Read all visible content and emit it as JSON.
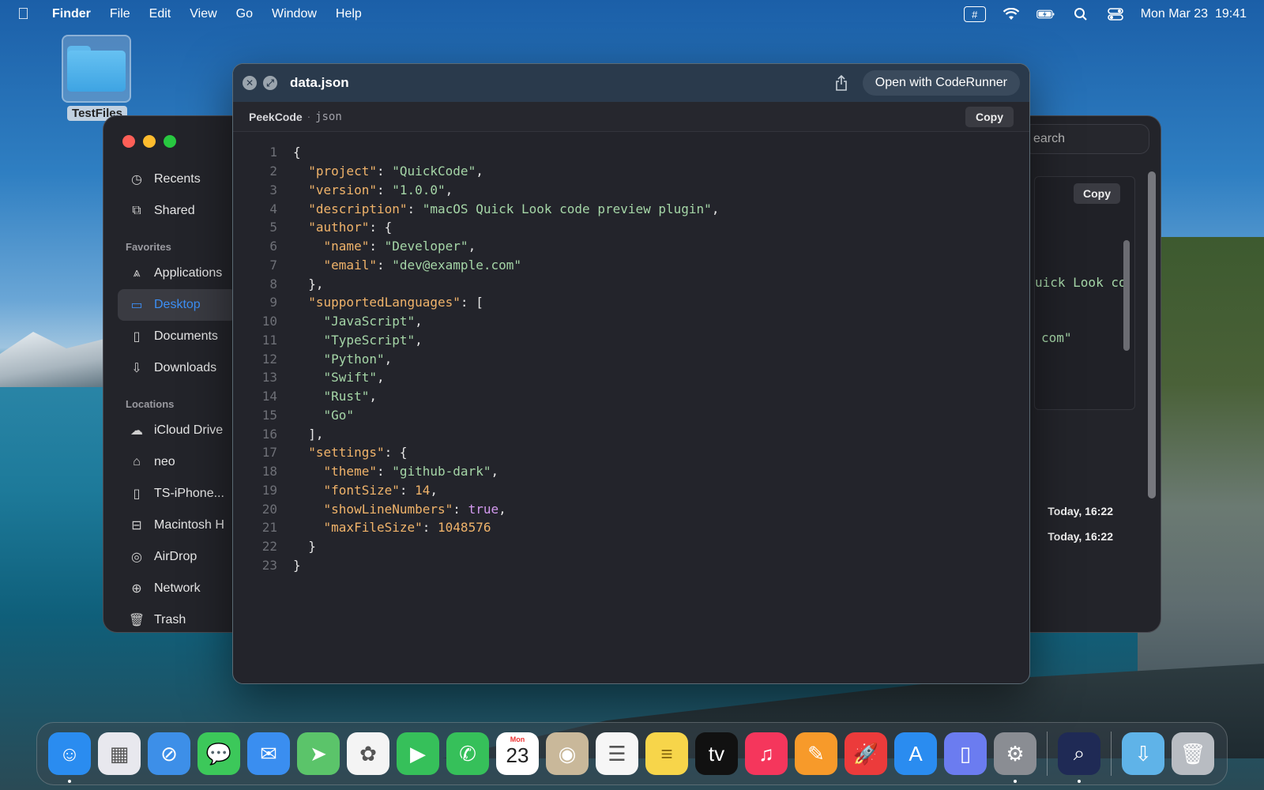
{
  "menubar": {
    "app_name": "Finder",
    "menus": [
      "File",
      "Edit",
      "View",
      "Go",
      "Window",
      "Help"
    ],
    "clock": "Mon Mar 23  19:41",
    "status_icons": [
      "input-method-icon",
      "wifi-icon",
      "battery-icon",
      "spotlight-search-icon",
      "control-center-icon"
    ]
  },
  "desktop": {
    "folder_label": "TestFiles"
  },
  "finder": {
    "search_placeholder": "earch",
    "sidebar": {
      "items_top": [
        {
          "label": "Recents",
          "icon": "clock-icon"
        },
        {
          "label": "Shared",
          "icon": "shared-folder-icon"
        }
      ],
      "favorites_label": "Favorites",
      "favorites": [
        {
          "label": "Applications",
          "icon": "applications-icon"
        },
        {
          "label": "Desktop",
          "icon": "desktop-icon",
          "active": true
        },
        {
          "label": "Documents",
          "icon": "document-icon"
        },
        {
          "label": "Downloads",
          "icon": "download-icon"
        }
      ],
      "locations_label": "Locations",
      "locations": [
        {
          "label": "iCloud Drive",
          "icon": "cloud-icon"
        },
        {
          "label": "neo",
          "icon": "home-icon"
        },
        {
          "label": "TS-iPhone...",
          "icon": "iphone-icon"
        },
        {
          "label": "Macintosh H",
          "icon": "disk-icon"
        },
        {
          "label": "AirDrop",
          "icon": "airdrop-icon"
        },
        {
          "label": "Network",
          "icon": "network-icon"
        },
        {
          "label": "Trash",
          "icon": "trash-icon"
        }
      ]
    },
    "preview_copy_label": "Copy",
    "preview_fragments": [
      "uick Look co",
      "com\""
    ],
    "dates": [
      "Today, 16:22",
      "Today, 16:22"
    ]
  },
  "quicklook": {
    "title": "data.json",
    "open_with_label": "Open with CodeRunner",
    "plugin_name": "PeekCode",
    "separator": "·",
    "language": "json",
    "copy_label": "Copy",
    "lines": [
      [
        {
          "t": "p",
          "v": "{"
        }
      ],
      [
        {
          "t": "p",
          "v": "  "
        },
        {
          "t": "key",
          "v": "\"project\""
        },
        {
          "t": "p",
          "v": ": "
        },
        {
          "t": "str",
          "v": "\"QuickCode\""
        },
        {
          "t": "p",
          "v": ","
        }
      ],
      [
        {
          "t": "p",
          "v": "  "
        },
        {
          "t": "key",
          "v": "\"version\""
        },
        {
          "t": "p",
          "v": ": "
        },
        {
          "t": "str",
          "v": "\"1.0.0\""
        },
        {
          "t": "p",
          "v": ","
        }
      ],
      [
        {
          "t": "p",
          "v": "  "
        },
        {
          "t": "key",
          "v": "\"description\""
        },
        {
          "t": "p",
          "v": ": "
        },
        {
          "t": "str",
          "v": "\"macOS Quick Look code preview plugin\""
        },
        {
          "t": "p",
          "v": ","
        }
      ],
      [
        {
          "t": "p",
          "v": "  "
        },
        {
          "t": "key",
          "v": "\"author\""
        },
        {
          "t": "p",
          "v": ": {"
        }
      ],
      [
        {
          "t": "p",
          "v": "    "
        },
        {
          "t": "key",
          "v": "\"name\""
        },
        {
          "t": "p",
          "v": ": "
        },
        {
          "t": "str",
          "v": "\"Developer\""
        },
        {
          "t": "p",
          "v": ","
        }
      ],
      [
        {
          "t": "p",
          "v": "    "
        },
        {
          "t": "key",
          "v": "\"email\""
        },
        {
          "t": "p",
          "v": ": "
        },
        {
          "t": "str",
          "v": "\"dev@example.com\""
        }
      ],
      [
        {
          "t": "p",
          "v": "  },"
        }
      ],
      [
        {
          "t": "p",
          "v": "  "
        },
        {
          "t": "key",
          "v": "\"supportedLanguages\""
        },
        {
          "t": "p",
          "v": ": ["
        }
      ],
      [
        {
          "t": "p",
          "v": "    "
        },
        {
          "t": "str",
          "v": "\"JavaScript\""
        },
        {
          "t": "p",
          "v": ","
        }
      ],
      [
        {
          "t": "p",
          "v": "    "
        },
        {
          "t": "str",
          "v": "\"TypeScript\""
        },
        {
          "t": "p",
          "v": ","
        }
      ],
      [
        {
          "t": "p",
          "v": "    "
        },
        {
          "t": "str",
          "v": "\"Python\""
        },
        {
          "t": "p",
          "v": ","
        }
      ],
      [
        {
          "t": "p",
          "v": "    "
        },
        {
          "t": "str",
          "v": "\"Swift\""
        },
        {
          "t": "p",
          "v": ","
        }
      ],
      [
        {
          "t": "p",
          "v": "    "
        },
        {
          "t": "str",
          "v": "\"Rust\""
        },
        {
          "t": "p",
          "v": ","
        }
      ],
      [
        {
          "t": "p",
          "v": "    "
        },
        {
          "t": "str",
          "v": "\"Go\""
        }
      ],
      [
        {
          "t": "p",
          "v": "  ],"
        }
      ],
      [
        {
          "t": "p",
          "v": "  "
        },
        {
          "t": "key",
          "v": "\"settings\""
        },
        {
          "t": "p",
          "v": ": {"
        }
      ],
      [
        {
          "t": "p",
          "v": "    "
        },
        {
          "t": "key",
          "v": "\"theme\""
        },
        {
          "t": "p",
          "v": ": "
        },
        {
          "t": "str",
          "v": "\"github-dark\""
        },
        {
          "t": "p",
          "v": ","
        }
      ],
      [
        {
          "t": "p",
          "v": "    "
        },
        {
          "t": "key",
          "v": "\"fontSize\""
        },
        {
          "t": "p",
          "v": ": "
        },
        {
          "t": "num",
          "v": "14"
        },
        {
          "t": "p",
          "v": ","
        }
      ],
      [
        {
          "t": "p",
          "v": "    "
        },
        {
          "t": "key",
          "v": "\"showLineNumbers\""
        },
        {
          "t": "p",
          "v": ": "
        },
        {
          "t": "kw",
          "v": "true"
        },
        {
          "t": "p",
          "v": ","
        }
      ],
      [
        {
          "t": "p",
          "v": "    "
        },
        {
          "t": "key",
          "v": "\"maxFileSize\""
        },
        {
          "t": "p",
          "v": ": "
        },
        {
          "t": "num",
          "v": "1048576"
        }
      ],
      [
        {
          "t": "p",
          "v": "  }"
        }
      ],
      [
        {
          "t": "p",
          "v": "}"
        }
      ]
    ]
  },
  "dock": {
    "apps": [
      {
        "name": "finder-app-icon",
        "color": "#2a8cf0",
        "glyph": "☺",
        "running": true
      },
      {
        "name": "launchpad-app-icon",
        "color": "#e8e8ee",
        "glyph": "▦",
        "running": false
      },
      {
        "name": "safari-app-icon",
        "color": "#3d8fe8",
        "glyph": "⊘",
        "running": false
      },
      {
        "name": "messages-app-icon",
        "color": "#3cc85a",
        "glyph": "💬",
        "running": false
      },
      {
        "name": "mail-app-icon",
        "color": "#3a8ef0",
        "glyph": "✉",
        "running": false
      },
      {
        "name": "maps-app-icon",
        "color": "#5bc46a",
        "glyph": "➤",
        "running": false
      },
      {
        "name": "photos-app-icon",
        "color": "#f4f4f4",
        "glyph": "✿",
        "running": false
      },
      {
        "name": "facetime-app-icon",
        "color": "#36c05a",
        "glyph": "▶",
        "running": false
      },
      {
        "name": "phone-app-icon",
        "color": "#36c05a",
        "glyph": "✆",
        "running": false
      },
      {
        "name": "calendar-app-icon",
        "color": "#ffffff",
        "glyph": "",
        "running": false,
        "cal_day": "Mon",
        "cal_num": "23"
      },
      {
        "name": "contacts-app-icon",
        "color": "#c9b89a",
        "glyph": "◉",
        "running": false
      },
      {
        "name": "reminders-app-icon",
        "color": "#f6f6f6",
        "glyph": "☰",
        "running": false
      },
      {
        "name": "notes-app-icon",
        "color": "#f7d54a",
        "glyph": "≡",
        "running": false
      },
      {
        "name": "apple-tv-app-icon",
        "color": "#111111",
        "glyph": "tv",
        "running": false
      },
      {
        "name": "music-app-icon",
        "color": "#f5365c",
        "glyph": "♫",
        "running": false
      },
      {
        "name": "pages-app-icon",
        "color": "#f79a2a",
        "glyph": "✎",
        "running": false
      },
      {
        "name": "rocket-app-icon",
        "color": "#ec3b3b",
        "glyph": "🚀",
        "running": false
      },
      {
        "name": "app-store-app-icon",
        "color": "#2a8cf0",
        "glyph": "A",
        "running": false
      },
      {
        "name": "iphone-mirroring-app-icon",
        "color": "#6b7cf0",
        "glyph": "▯",
        "running": false
      },
      {
        "name": "system-settings-app-icon",
        "color": "#8a8d93",
        "glyph": "⚙",
        "running": true
      },
      {
        "sep": true
      },
      {
        "name": "peekcode-app-icon",
        "color": "#1f2a55",
        "glyph": "⌕",
        "running": true
      },
      {
        "sep": true
      },
      {
        "name": "downloads-stack-icon",
        "color": "#5fb3e8",
        "glyph": "⇩",
        "running": false
      },
      {
        "name": "trash-dock-icon",
        "color": "#b8bcc2",
        "glyph": "🗑",
        "running": false
      }
    ]
  }
}
